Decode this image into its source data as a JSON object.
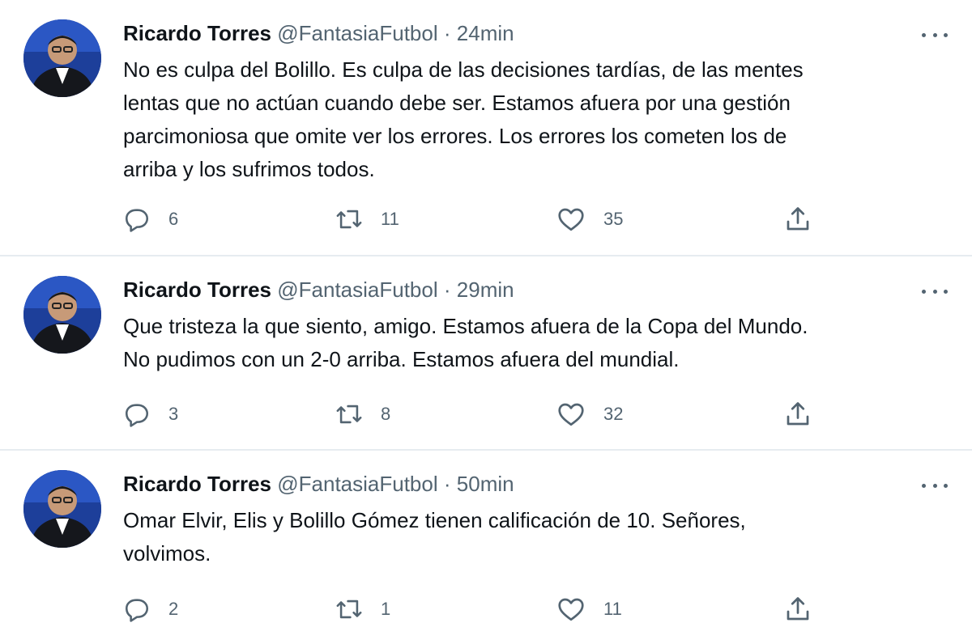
{
  "tweets": [
    {
      "name": "Ricardo Torres",
      "handle": "@FantasiaFutbol",
      "separator": "·",
      "time": "24min",
      "text_lines": [
        "No es culpa del Bolillo. Es culpa de las decisiones tardías, de las mentes",
        "lentas que no actúan cuando debe ser. Estamos afuera por una gestión",
        "parcimoniosa que omite ver los errores. Los errores los cometen los de",
        "arriba y los sufrimos todos."
      ],
      "replies": "6",
      "retweets": "11",
      "likes": "35"
    },
    {
      "name": "Ricardo Torres",
      "handle": "@FantasiaFutbol",
      "separator": "·",
      "time": "29min",
      "text_lines": [
        "Que tristeza la que siento, amigo. Estamos afuera de la Copa del Mundo.",
        "No pudimos con un 2-0 arriba. Estamos afuera del mundial."
      ],
      "replies": "3",
      "retweets": "8",
      "likes": "32"
    },
    {
      "name": "Ricardo Torres",
      "handle": "@FantasiaFutbol",
      "separator": "·",
      "time": "50min",
      "text_lines": [
        "Omar Elvir, Elis y Bolillo Gómez tienen calificación de 10. Señores,",
        "volvimos."
      ],
      "replies": "2",
      "retweets": "1",
      "likes": "11"
    }
  ],
  "icons": {
    "reply": "reply-icon",
    "retweet": "retweet-icon",
    "like": "heart-icon",
    "share": "share-icon",
    "more": "more-options-icon"
  },
  "colors": {
    "text": "#0f1419",
    "secondary": "#536471",
    "divider": "#e6ecf0",
    "avatar_bg": "#1d3f9a"
  }
}
